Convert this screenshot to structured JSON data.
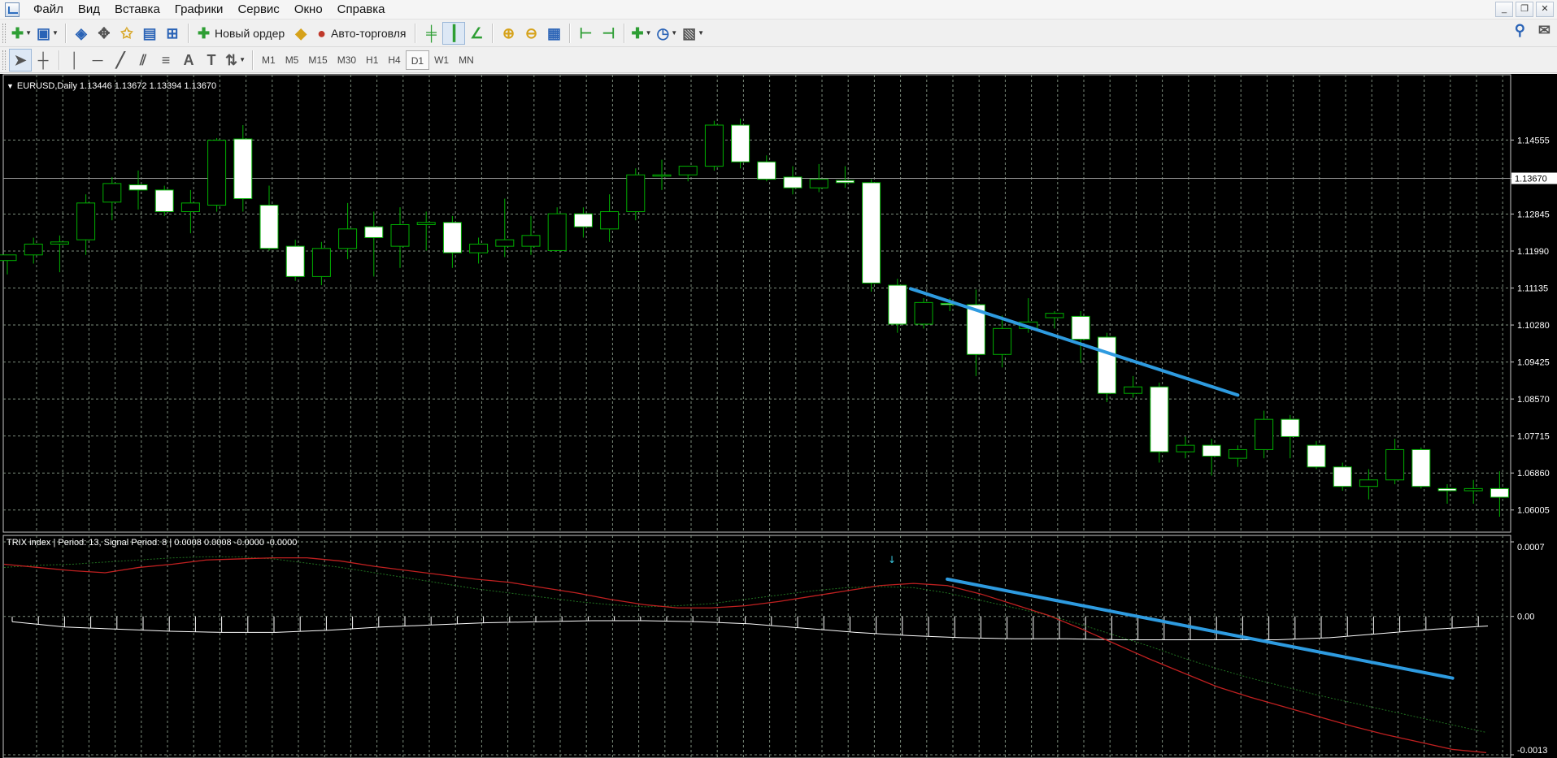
{
  "menu": [
    "Файл",
    "Вид",
    "Вставка",
    "Графики",
    "Сервис",
    "Окно",
    "Справка"
  ],
  "window_controls": [
    "_",
    "❐",
    "✕"
  ],
  "toolbar1": {
    "new_order_label": "Новый ордер",
    "auto_trading_label": "Авто-торговля"
  },
  "toolbar2": {
    "timeframes": [
      "M1",
      "M5",
      "M15",
      "M30",
      "H1",
      "H4",
      "D1",
      "W1",
      "MN"
    ],
    "active_timeframe": "D1",
    "text_tool": "A",
    "label_tool": "T"
  },
  "main_pane": {
    "title": "EURUSD,Daily  1.13446 1.13672 1.13394 1.13670",
    "price_ticks": [
      "1.14555",
      "1.13670",
      "1.12845",
      "1.11990",
      "1.11135",
      "1.10280",
      "1.09425",
      "1.08570",
      "1.07715",
      "1.06860",
      "1.06005"
    ],
    "current_price": "1.13670"
  },
  "indicator_pane": {
    "title": "TRIX index | Period: 13, Signal Period: 8 |  0.0008 0.0008 -0.0000 -0.0000",
    "scale_ticks": [
      "0.0007",
      "0.00",
      "-0.0013"
    ]
  },
  "colors": {
    "background": "#000000",
    "grid": "#7c8c7c",
    "candle_bull": "#000000",
    "candle_bear": "#ffffff",
    "candle_outline": "#00b000",
    "trix_line": "#c02020",
    "signal_line": "#207020",
    "histogram": "#ffffff",
    "trendline": "#2e9be0",
    "current_price_label_bg": "#ffffff"
  },
  "chart_data": [
    {
      "type": "candlestick",
      "symbol": "EURUSD",
      "timeframe": "Daily",
      "y_range": [
        1.0585,
        1.1505
      ],
      "candles": [
        [
          1.1177,
          1.119,
          1.1145,
          1.119
        ],
        [
          1.119,
          1.123,
          1.117,
          1.1215
        ],
        [
          1.1215,
          1.1235,
          1.115,
          1.122
        ],
        [
          1.1225,
          1.133,
          1.119,
          1.131
        ],
        [
          1.1312,
          1.137,
          1.127,
          1.1355
        ],
        [
          1.1352,
          1.1385,
          1.1295,
          1.134
        ],
        [
          1.134,
          1.135,
          1.128,
          1.129
        ],
        [
          1.129,
          1.134,
          1.124,
          1.131
        ],
        [
          1.1305,
          1.146,
          1.129,
          1.1455
        ],
        [
          1.1458,
          1.149,
          1.129,
          1.132
        ],
        [
          1.1305,
          1.135,
          1.12,
          1.1205
        ],
        [
          1.121,
          1.1225,
          1.113,
          1.114
        ],
        [
          1.114,
          1.122,
          1.112,
          1.1205
        ],
        [
          1.1205,
          1.131,
          1.118,
          1.125
        ],
        [
          1.1255,
          1.129,
          1.114,
          1.123
        ],
        [
          1.121,
          1.13,
          1.116,
          1.126
        ],
        [
          1.126,
          1.129,
          1.12,
          1.1265
        ],
        [
          1.1265,
          1.128,
          1.116,
          1.1195
        ],
        [
          1.1195,
          1.123,
          1.117,
          1.1215
        ],
        [
          1.121,
          1.132,
          1.1185,
          1.1225
        ],
        [
          1.121,
          1.128,
          1.119,
          1.1235
        ],
        [
          1.12,
          1.13,
          1.12,
          1.1285
        ],
        [
          1.1285,
          1.13,
          1.123,
          1.1255
        ],
        [
          1.125,
          1.133,
          1.122,
          1.129
        ],
        [
          1.129,
          1.139,
          1.127,
          1.1375
        ],
        [
          1.1372,
          1.141,
          1.134,
          1.1375
        ],
        [
          1.1375,
          1.139,
          1.136,
          1.1395
        ],
        [
          1.1395,
          1.15,
          1.1385,
          1.149
        ],
        [
          1.149,
          1.1505,
          1.139,
          1.1405
        ],
        [
          1.1405,
          1.142,
          1.136,
          1.1365
        ],
        [
          1.137,
          1.1395,
          1.133,
          1.1345
        ],
        [
          1.1345,
          1.14,
          1.1335,
          1.1365
        ],
        [
          1.1362,
          1.1395,
          1.1345,
          1.1357
        ],
        [
          1.1357,
          1.1365,
          1.1105,
          1.1125
        ],
        [
          1.112,
          1.1135,
          1.101,
          1.103
        ],
        [
          1.103,
          1.109,
          1.102,
          1.108
        ],
        [
          1.1078,
          1.109,
          1.106,
          1.1075
        ],
        [
          1.1075,
          1.111,
          1.091,
          1.096
        ],
        [
          1.096,
          1.105,
          1.093,
          1.102
        ],
        [
          1.102,
          1.109,
          1.101,
          1.1035
        ],
        [
          1.1045,
          1.106,
          1.102,
          1.1055
        ],
        [
          1.1048,
          1.106,
          1.094,
          1.0995
        ],
        [
          1.1,
          1.101,
          1.085,
          1.087
        ],
        [
          1.087,
          1.091,
          1.086,
          1.0885
        ],
        [
          1.0885,
          1.0895,
          1.071,
          1.0735
        ],
        [
          1.0735,
          1.077,
          1.072,
          1.075
        ],
        [
          1.075,
          1.0765,
          1.068,
          1.0725
        ],
        [
          1.072,
          1.075,
          1.07,
          1.074
        ],
        [
          1.074,
          1.083,
          1.072,
          1.081
        ],
        [
          1.081,
          1.082,
          1.072,
          1.077
        ],
        [
          1.075,
          1.076,
          1.0695,
          1.07
        ],
        [
          1.07,
          1.071,
          1.0645,
          1.0655
        ],
        [
          1.0655,
          1.0695,
          1.0625,
          1.067
        ],
        [
          1.067,
          1.0765,
          1.066,
          1.074
        ],
        [
          1.074,
          1.0745,
          1.065,
          1.0655
        ],
        [
          1.065,
          1.066,
          1.0615,
          1.0645
        ],
        [
          1.0645,
          1.067,
          1.0615,
          1.065
        ],
        [
          1.065,
          1.069,
          1.0585,
          1.063
        ]
      ],
      "trendline": {
        "from_index": 34.5,
        "from_price": 1.1112,
        "to_index": 47,
        "to_price": 1.0866
      }
    },
    {
      "type": "line",
      "title": "TRIX index | Period: 13, Signal Period: 8",
      "y_range": [
        -0.0013,
        0.0007
      ],
      "series": [
        {
          "values": [
            0.00049,
            0.00046,
            0.00043,
            0.00041,
            0.00046,
            0.00049,
            0.00053,
            0.00054,
            0.00055,
            0.00055,
            0.00052,
            0.00047,
            0.00043,
            0.00039,
            0.00035,
            0.00032,
            0.00027,
            0.00022,
            0.00016,
            0.00011,
            8e-05,
            8e-05,
            0.0001,
            0.00014,
            0.00019,
            0.00024,
            0.00029,
            0.00031,
            0.00029,
            0.00021,
            0.00011,
            1e-05,
            -0.00012,
            -0.00026,
            -0.0004,
            -0.00053,
            -0.00066,
            -0.00076,
            -0.00085,
            -0.00094,
            -0.00103,
            -0.00111,
            -0.00118,
            -0.00125,
            -0.00128
          ]
        },
        {
          "values": [
            0.00046,
            0.00048,
            0.00049,
            0.00051,
            0.00053,
            0.00055,
            0.00056,
            0.00056,
            0.00054,
            0.0005,
            0.00046,
            0.00041,
            0.00036,
            0.00031,
            0.00026,
            0.00022,
            0.00018,
            0.00014,
            0.00011,
            9e-05,
            0.0001,
            0.00012,
            0.00016,
            0.0002,
            0.00024,
            0.00027,
            0.00028,
            0.00027,
            0.00022,
            0.00015,
            8e-05,
            1e-05,
            -8e-05,
            -0.00018,
            -0.00028,
            -0.00039,
            -0.00049,
            -0.00058,
            -0.00066,
            -0.00074,
            -0.00081,
            -0.00088,
            -0.00095,
            -0.00102,
            -0.00109
          ]
        },
        {
          "values": [
            -5e-05,
            -0.0001,
            -0.00012,
            -0.00014,
            -0.00015,
            -0.00015,
            -0.00013,
            -0.0001,
            -8e-05,
            -6e-05,
            -5e-05,
            -4e-05,
            -4e-05,
            -5e-05,
            -7e-05,
            -0.00011,
            -0.00015,
            -0.00018,
            -0.0002,
            -0.00021,
            -0.00021,
            -0.00022,
            -0.00022,
            -0.00022,
            -0.00022,
            -0.0002,
            -0.00016,
            -0.00012,
            -9e-05
          ]
        }
      ],
      "trendline": {
        "from_index": 28,
        "from_value": 0.00035,
        "to_index": 43,
        "to_value": -0.00058
      }
    }
  ]
}
